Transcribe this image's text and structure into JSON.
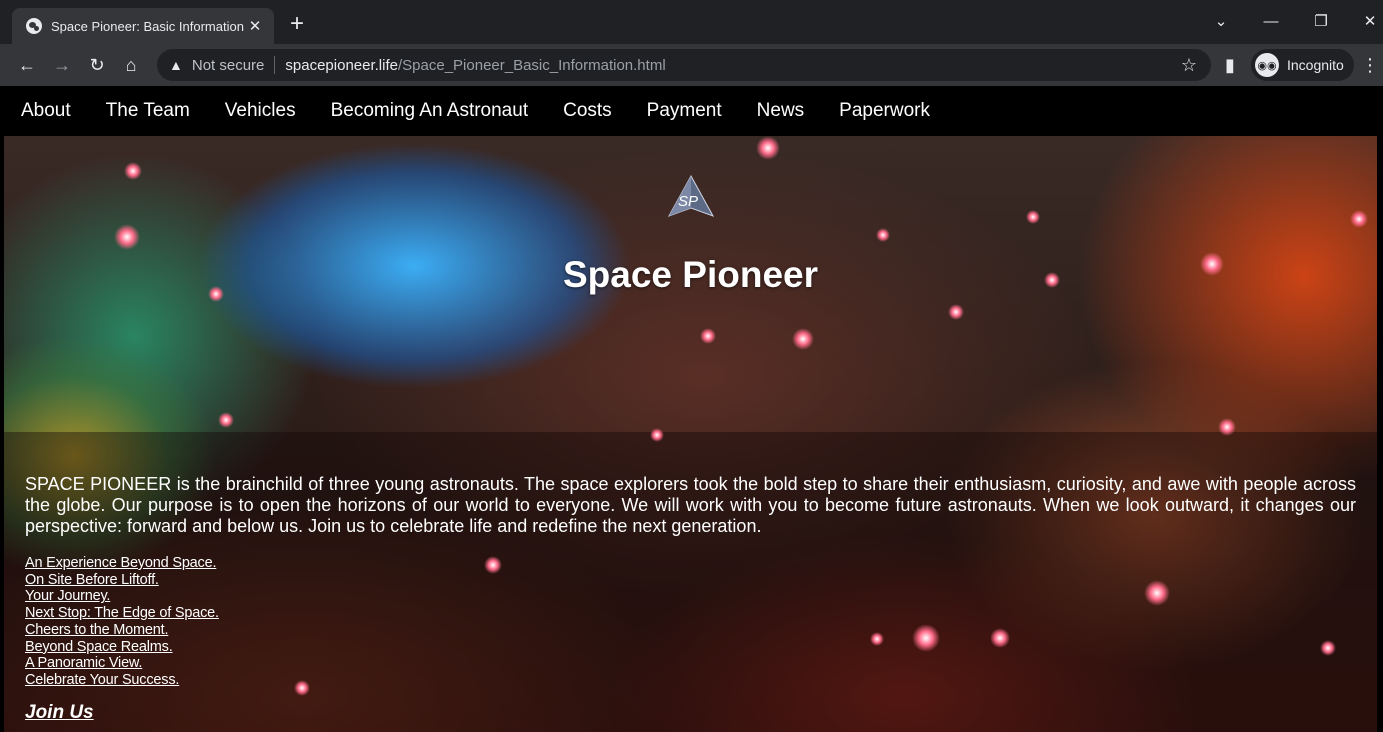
{
  "browser": {
    "tab_title": "Space Pioneer: Basic Information",
    "tab_close": "✕",
    "new_tab": "+",
    "security_label": "Not secure",
    "url_host": "spacepioneer.life",
    "url_path": "/Space_Pioneer_Basic_Information.html",
    "profile_label": "Incognito",
    "icons": {
      "favicon": "globe-icon",
      "back": "←",
      "forward": "→",
      "reload": "↻",
      "home": "⌂",
      "warning": "▲",
      "bookmark": "☆",
      "side_panel": "▮",
      "menu": "⋮",
      "tab_search": "⌄",
      "minimize": "—",
      "restore": "❐",
      "close": "✕"
    }
  },
  "nav": {
    "items": [
      "About",
      "The Team",
      "Vehicles",
      "Becoming An Astronaut",
      "Costs",
      "Payment",
      "News",
      "Paperwork"
    ]
  },
  "hero": {
    "logo_text": "SP",
    "title": "Space Pioneer"
  },
  "main": {
    "intro": "SPACE PIONEER is the brainchild of three young astronauts. The space explorers took the bold step to share their enthusiasm, curiosity, and awe with people across the globe. Our purpose is to open the horizons of our world to everyone. We will work with you to become future astronauts. When we look outward, it changes our perspective: forward and below us. Join us to celebrate life and redefine the next generation.",
    "links": [
      "An Experience Beyond Space.",
      "On Site Before Liftoff.",
      "Your Journey.",
      "Next Stop: The Edge of Space.",
      "Cheers to the Moment.",
      "Beyond Space Realms.",
      "A Panoramic View.",
      "Celebrate Your Success."
    ],
    "join_label": "Join Us"
  }
}
